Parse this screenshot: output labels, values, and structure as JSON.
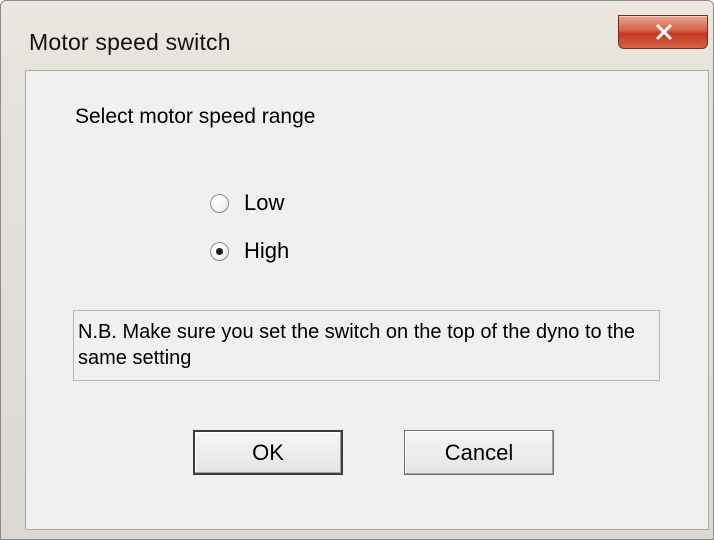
{
  "window": {
    "title": "Motor speed switch",
    "close_icon": "close-x-icon"
  },
  "dialog": {
    "prompt": "Select motor speed range",
    "options": [
      {
        "label": "Low",
        "checked": false
      },
      {
        "label": "High",
        "checked": true
      }
    ],
    "note": "N.B. Make sure you set the switch on the top of the dyno to the same setting",
    "ok_label": "OK",
    "cancel_label": "Cancel"
  },
  "colors": {
    "close_button": "#c33a22",
    "dialog_bg": "#f0f0f0",
    "frame_bg": "#e6e2dc"
  }
}
